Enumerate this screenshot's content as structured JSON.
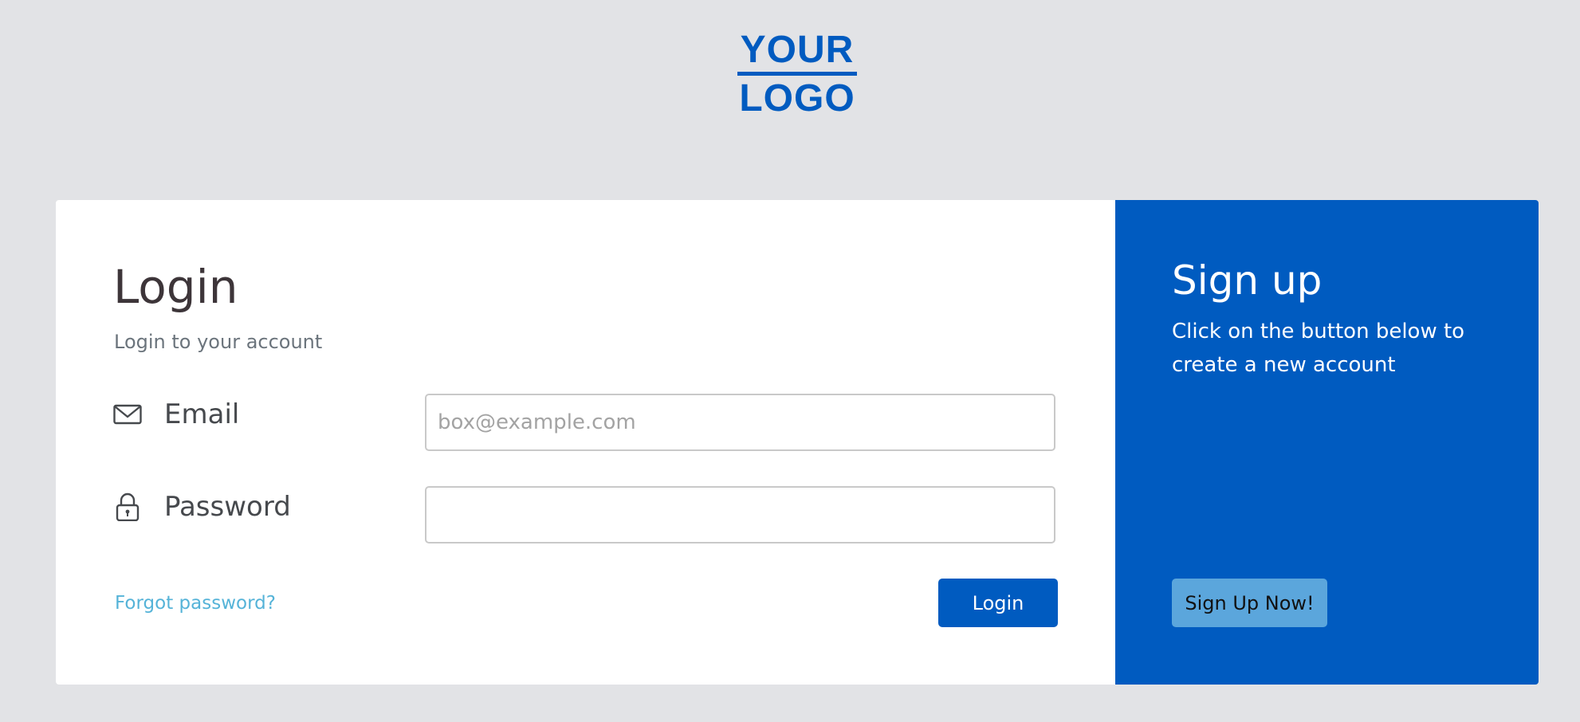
{
  "logo": {
    "line1": "YOUR",
    "line2": "LOGO",
    "color": "#005bc0"
  },
  "login": {
    "title": "Login",
    "subtitle": "Login to your account",
    "email": {
      "label": "Email",
      "icon": "envelope-icon",
      "placeholder": "box@example.com",
      "value": ""
    },
    "password": {
      "label": "Password",
      "icon": "lock-icon",
      "placeholder": "",
      "value": ""
    },
    "forgot_label": "Forgot password?",
    "button_label": "Login"
  },
  "signup": {
    "title": "Sign up",
    "text": "Click on the button below to create a new account",
    "button_label": "Sign Up Now!"
  },
  "colors": {
    "page_background": "#e2e3e6",
    "brand_blue": "#005bc0",
    "link": "#55b3d8",
    "signup_button": "#5ba6dc"
  }
}
